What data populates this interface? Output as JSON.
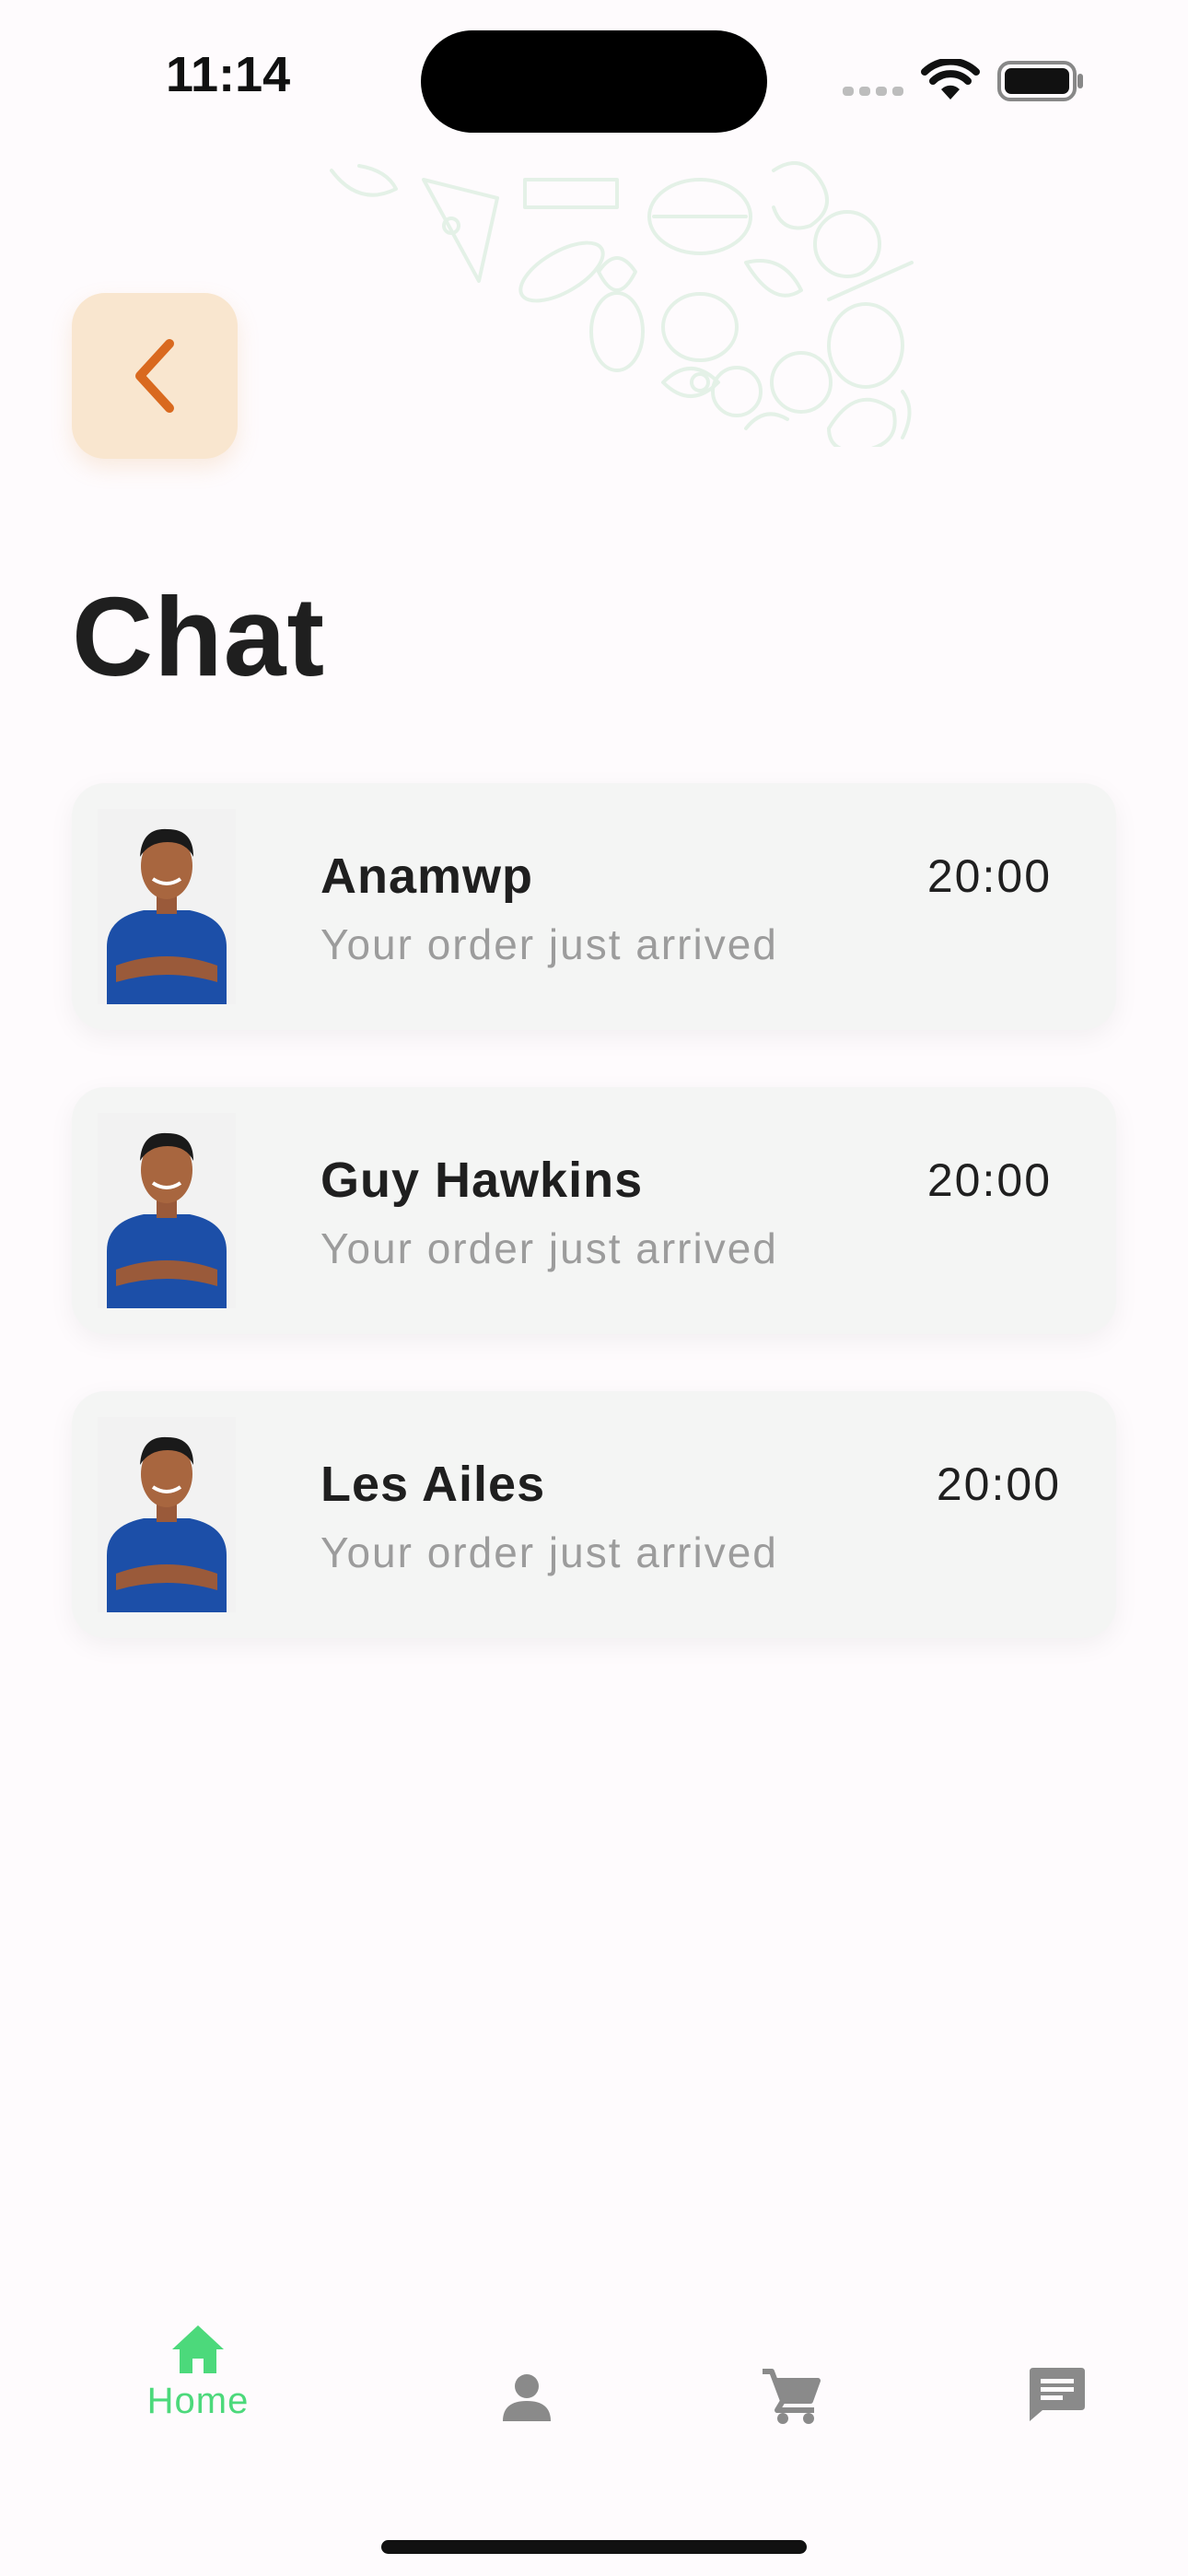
{
  "status_bar": {
    "time": "11:14"
  },
  "header": {
    "title": "Chat"
  },
  "chats": [
    {
      "name": "Anamwp",
      "preview": "Your order just arrived",
      "time": "20:00"
    },
    {
      "name": "Guy Hawkins",
      "preview": "Your order just arrived",
      "time": "20:00"
    },
    {
      "name": "Les Ailes",
      "preview": "Your order just arrived",
      "time": "20:00"
    }
  ],
  "bottom_nav": {
    "home_label": "Home",
    "active": "home",
    "icons": [
      "home-icon",
      "profile-icon",
      "cart-icon",
      "chat-icon"
    ]
  },
  "colors": {
    "accent": "#4cd97b",
    "back_button_bg": "#f9e6cf",
    "back_chevron": "#d9691f",
    "inactive_icon": "#8a8a8a"
  }
}
